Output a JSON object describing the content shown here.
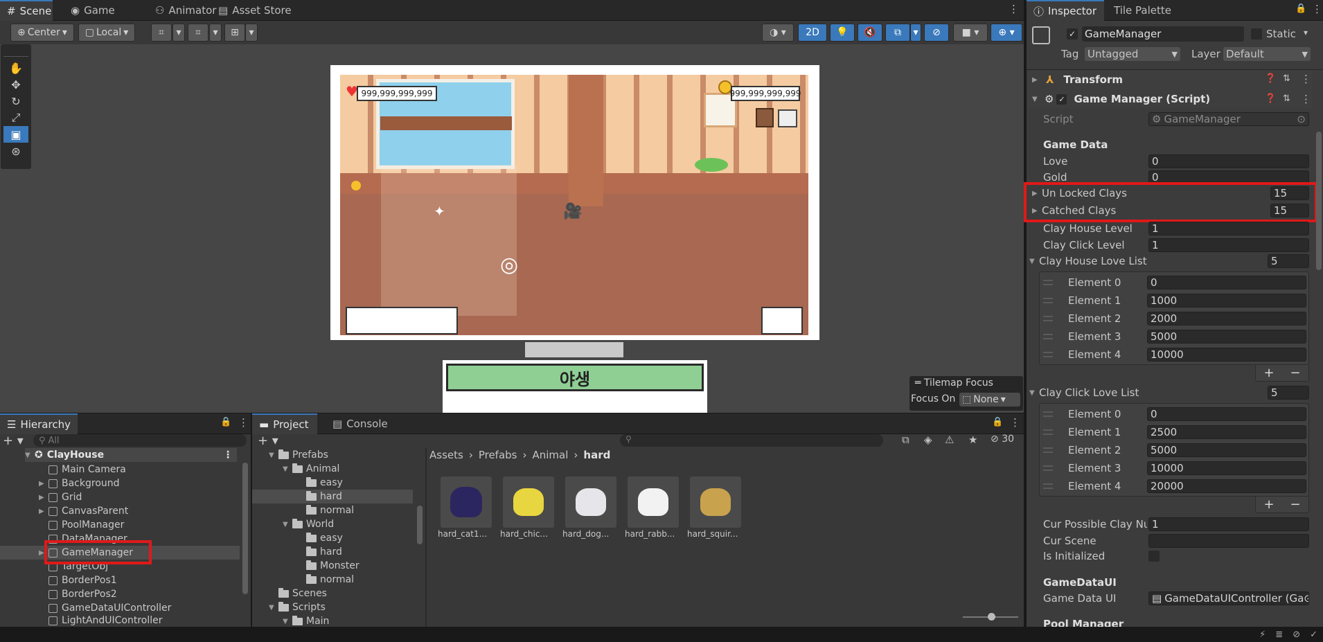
{
  "colors": {
    "accent": "#3a79bb",
    "highlight": "#e01919",
    "bg": "#383838"
  },
  "scene_tabs": [
    {
      "label": "Scene",
      "icon": "grid-icon"
    },
    {
      "label": "Game",
      "icon": "gamepad-icon"
    },
    {
      "label": "Animator",
      "icon": "animator-icon"
    },
    {
      "label": "Asset Store",
      "icon": "store-icon"
    }
  ],
  "toolbar": {
    "pivot": "Center",
    "space": "Local",
    "mode_2d": "2D"
  },
  "game_view": {
    "hud_left_value": "999,999,999,999",
    "hud_right_value": "999,999,999,999",
    "bottom_title": "야생"
  },
  "tilemap": {
    "title": "Tilemap Focus",
    "focus_label": "Focus On",
    "focus_value": "None"
  },
  "hierarchy": {
    "title": "Hierarchy",
    "search_placeholder": "All",
    "root": "ClayHouse",
    "items": [
      "Main Camera",
      "Background",
      "Grid",
      "CanvasParent",
      "PoolManager",
      "DataManager",
      "GameManager",
      "TargetObj",
      "BorderPos1",
      "BorderPos2",
      "GameDataUIController",
      "LightAndUIController"
    ]
  },
  "project": {
    "tab_project": "Project",
    "tab_console": "Console",
    "hidden_count": "30",
    "tree": [
      {
        "label": "Prefabs",
        "depth": 0
      },
      {
        "label": "Animal",
        "depth": 1
      },
      {
        "label": "easy",
        "depth": 2
      },
      {
        "label": "hard",
        "depth": 2
      },
      {
        "label": "normal",
        "depth": 2
      },
      {
        "label": "World",
        "depth": 1
      },
      {
        "label": "easy",
        "depth": 2
      },
      {
        "label": "hard",
        "depth": 2
      },
      {
        "label": "Monster",
        "depth": 2
      },
      {
        "label": "normal",
        "depth": 2
      },
      {
        "label": "Scenes",
        "depth": 0
      },
      {
        "label": "Scripts",
        "depth": 0
      },
      {
        "label": "Main",
        "depth": 1
      }
    ],
    "breadcrumb": [
      "Assets",
      "Prefabs",
      "Animal",
      "hard"
    ],
    "assets": [
      {
        "label": "hard_cat1...",
        "color": "#2b2660"
      },
      {
        "label": "hard_chic...",
        "color": "#e8d640"
      },
      {
        "label": "hard_dog...",
        "color": "#e6e6ea"
      },
      {
        "label": "hard_rabb...",
        "color": "#f2f2f2"
      },
      {
        "label": "hard_squir...",
        "color": "#c9a24e"
      }
    ]
  },
  "inspector": {
    "tab_inspector": "Inspector",
    "tab_tile": "Tile Palette",
    "object_name": "GameManager",
    "static_label": "Static",
    "tag_label": "Tag",
    "tag_value": "Untagged",
    "layer_label": "Layer",
    "layer_value": "Default",
    "transform": "Transform",
    "component": "Game Manager (Script)",
    "script_label": "Script",
    "script_value": "GameManager",
    "game_data_header": "Game Data",
    "love_label": "Love",
    "love_value": "0",
    "gold_label": "Gold",
    "gold_value": "0",
    "unlocked_label": "Un Locked Clays",
    "unlocked_value": "15",
    "catched_label": "Catched Clays",
    "catched_value": "15",
    "house_level_label": "Clay House Level",
    "house_level_value": "1",
    "click_level_label": "Clay Click Level",
    "click_level_value": "1",
    "house_love_label": "Clay House Love List",
    "house_love_count": "5",
    "house_love": [
      {
        "label": "Element 0",
        "value": "0"
      },
      {
        "label": "Element 1",
        "value": "1000"
      },
      {
        "label": "Element 2",
        "value": "2000"
      },
      {
        "label": "Element 3",
        "value": "5000"
      },
      {
        "label": "Element 4",
        "value": "10000"
      }
    ],
    "click_love_label": "Clay Click Love List",
    "click_love_count": "5",
    "click_love": [
      {
        "label": "Element 0",
        "value": "0"
      },
      {
        "label": "Element 1",
        "value": "2500"
      },
      {
        "label": "Element 2",
        "value": "5000"
      },
      {
        "label": "Element 3",
        "value": "10000"
      },
      {
        "label": "Element 4",
        "value": "20000"
      }
    ],
    "cur_possible_label": "Cur Possible Clay Nu",
    "cur_possible_value": "1",
    "cur_scene_label": "Cur Scene",
    "cur_scene_value": "",
    "initialized_label": "Is Initialized",
    "ui_header": "GameDataUI",
    "ui_label": "Game Data UI",
    "ui_value": "GameDataUIController (Ga",
    "pool_header": "Pool Manager"
  }
}
